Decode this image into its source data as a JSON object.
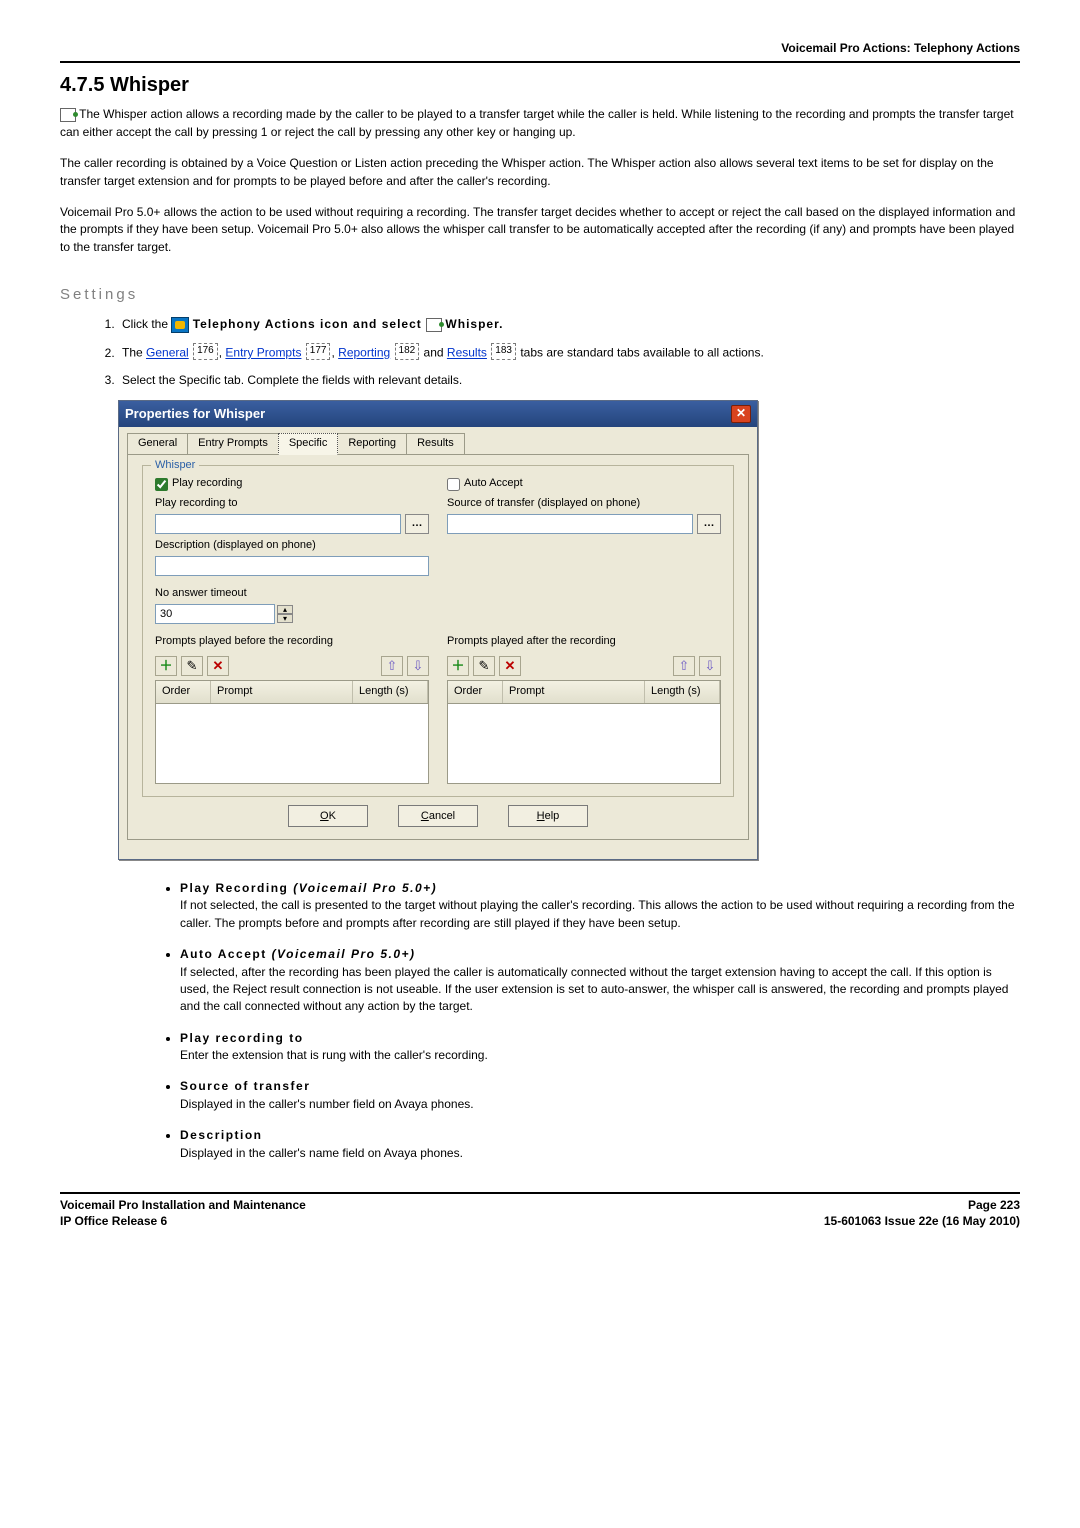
{
  "header": {
    "category": "Voicemail Pro Actions: Telephony Actions"
  },
  "section": {
    "number_title": "4.7.5 Whisper"
  },
  "intro": {
    "p1": " The Whisper action allows a recording made by the caller to be played to a transfer target while the caller is held. While listening to the recording and prompts the transfer target can either accept the call by pressing 1 or reject the call by pressing any other key or hanging up.",
    "p2": "The caller recording is obtained by a Voice Question or Listen action preceding the Whisper action. The Whisper action also allows several text items to be set for display on the transfer target extension and for prompts to be played before and after the caller's recording.",
    "p3": "Voicemail Pro 5.0+ allows the action to be used without requiring a recording. The transfer target decides whether to accept or reject the call based on the displayed information and the prompts if they have been setup. Voicemail Pro 5.0+ also allows the whisper call transfer to be automatically accepted after the recording (if any) and prompts have been played to the transfer target."
  },
  "settings": {
    "heading": "Settings",
    "step1_a": "Click the ",
    "step1_b": " Telephony Actions icon and select ",
    "step1_c": " Whisper.",
    "step2_a": "The ",
    "step2_links": {
      "general": "General",
      "ref1": "176",
      "entry": "Entry Prompts",
      "ref2": "177",
      "reporting": "Reporting",
      "ref3": "182",
      "results": "Results",
      "ref4": "183"
    },
    "step2_b": " tabs are standard tabs available to all actions.",
    "step3": "Select the Specific tab. Complete the fields with relevant details."
  },
  "dialog": {
    "title": "Properties for Whisper",
    "tabs": [
      "General",
      "Entry Prompts",
      "Specific",
      "Reporting",
      "Results"
    ],
    "active_tab": 2,
    "group_title": "Whisper",
    "play_recording": {
      "label": "Play recording",
      "checked": true
    },
    "auto_accept": {
      "label": "Auto Accept",
      "checked": false
    },
    "play_to": {
      "label": "Play recording to",
      "value": ""
    },
    "source": {
      "label": "Source of transfer (displayed on phone)",
      "value": ""
    },
    "description": {
      "label": "Description (displayed on phone)",
      "value": ""
    },
    "timeout": {
      "label": "No answer timeout",
      "value": "30"
    },
    "before": {
      "label": "Prompts played before the recording"
    },
    "after": {
      "label": "Prompts played after the recording"
    },
    "cols": {
      "order": "Order",
      "prompt": "Prompt",
      "length": "Length (s)"
    },
    "buttons": {
      "ok": "OK",
      "cancel": "Cancel",
      "help": "Help"
    }
  },
  "bullets": [
    {
      "title": "Play Recording ",
      "qual": "(Voicemail Pro 5.0+)",
      "text": "If not selected, the call is presented to the target without playing the caller's recording. This allows the action to be used without requiring a recording from the caller. The prompts before and prompts after recording are still played if they have been setup."
    },
    {
      "title": "Auto Accept ",
      "qual": "(Voicemail Pro 5.0+)",
      "text": "If selected, after the recording has been played the caller is automatically connected without the target extension having to accept the call. If this option is used, the Reject result connection is not useable. If the user extension is set to auto-answer, the whisper call is answered, the recording and prompts played and the call connected without any action by the target."
    },
    {
      "title": "Play recording to",
      "qual": "",
      "text": "Enter the extension that is rung with the caller's recording."
    },
    {
      "title": "Source of transfer",
      "qual": "",
      "text": "Displayed in the caller's number field on Avaya phones."
    },
    {
      "title": "Description",
      "qual": "",
      "text": "Displayed in the caller's name field on Avaya phones."
    }
  ],
  "footer": {
    "left1": "Voicemail Pro Installation and Maintenance",
    "left2": "IP Office Release 6",
    "right1": "Page 223",
    "right2": "15-601063 Issue 22e (16 May 2010)"
  }
}
